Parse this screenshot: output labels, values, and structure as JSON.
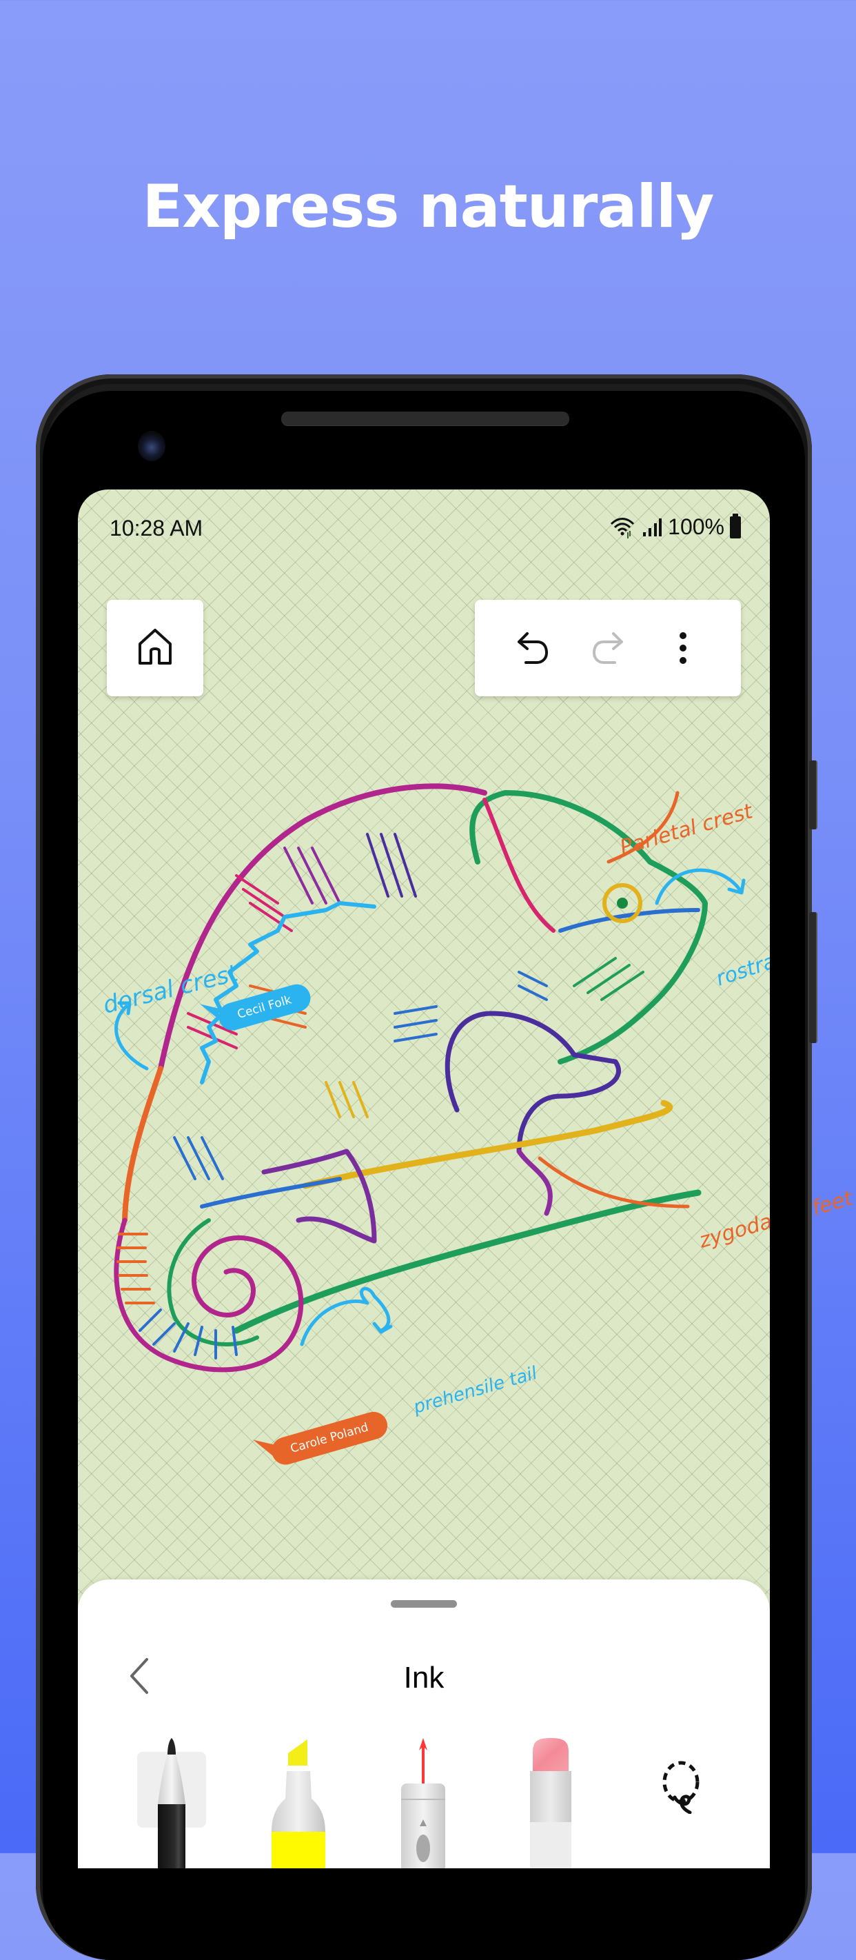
{
  "headline": "Express naturally",
  "status_bar": {
    "time": "10:28 AM",
    "battery": "100%",
    "icons": [
      "wifi-icon",
      "signal-icon",
      "battery-icon"
    ]
  },
  "top_toolbar": {
    "home_icon": "home-icon",
    "undo_icon": "undo-icon",
    "redo_icon": "redo-icon",
    "redo_enabled": false,
    "more_icon": "more-vertical-icon"
  },
  "canvas": {
    "background_color": "#DDE9C6",
    "annotations": [
      {
        "text": "dorsal crest",
        "color": "#2BB3F0"
      },
      {
        "text": "Parietal crest",
        "color": "#E8652A"
      },
      {
        "text": "rostral crest",
        "color": "#2BB3F0"
      },
      {
        "text": "zygodactyl feet",
        "color": "#E8652A"
      },
      {
        "text": "prehensile tail",
        "color": "#2BB3F0"
      }
    ],
    "collaborators": [
      {
        "name": "Cecil Folk",
        "color": "#2BB3F0"
      },
      {
        "name": "Carole Poland",
        "color": "#E8652A"
      }
    ]
  },
  "ink_sheet": {
    "title": "Ink",
    "back_icon": "chevron-left-icon",
    "tools": [
      {
        "name": "Pen",
        "icon": "pen-icon",
        "selected": true,
        "color": "#1a1a1a"
      },
      {
        "name": "Highlighter",
        "icon": "highlighter-icon",
        "selected": false,
        "color": "#FFF200"
      },
      {
        "name": "Laser pointer",
        "icon": "laser-pointer-icon",
        "selected": false,
        "color": "#FF2020"
      },
      {
        "name": "Eraser",
        "icon": "eraser-icon",
        "selected": false,
        "color": "#F4A0A8"
      },
      {
        "name": "Lasso select",
        "icon": "lasso-icon",
        "selected": false,
        "color": "#1a1a1a"
      }
    ]
  },
  "background": {
    "top": "#8A9CF9",
    "bottom": "#4A6AF7"
  }
}
